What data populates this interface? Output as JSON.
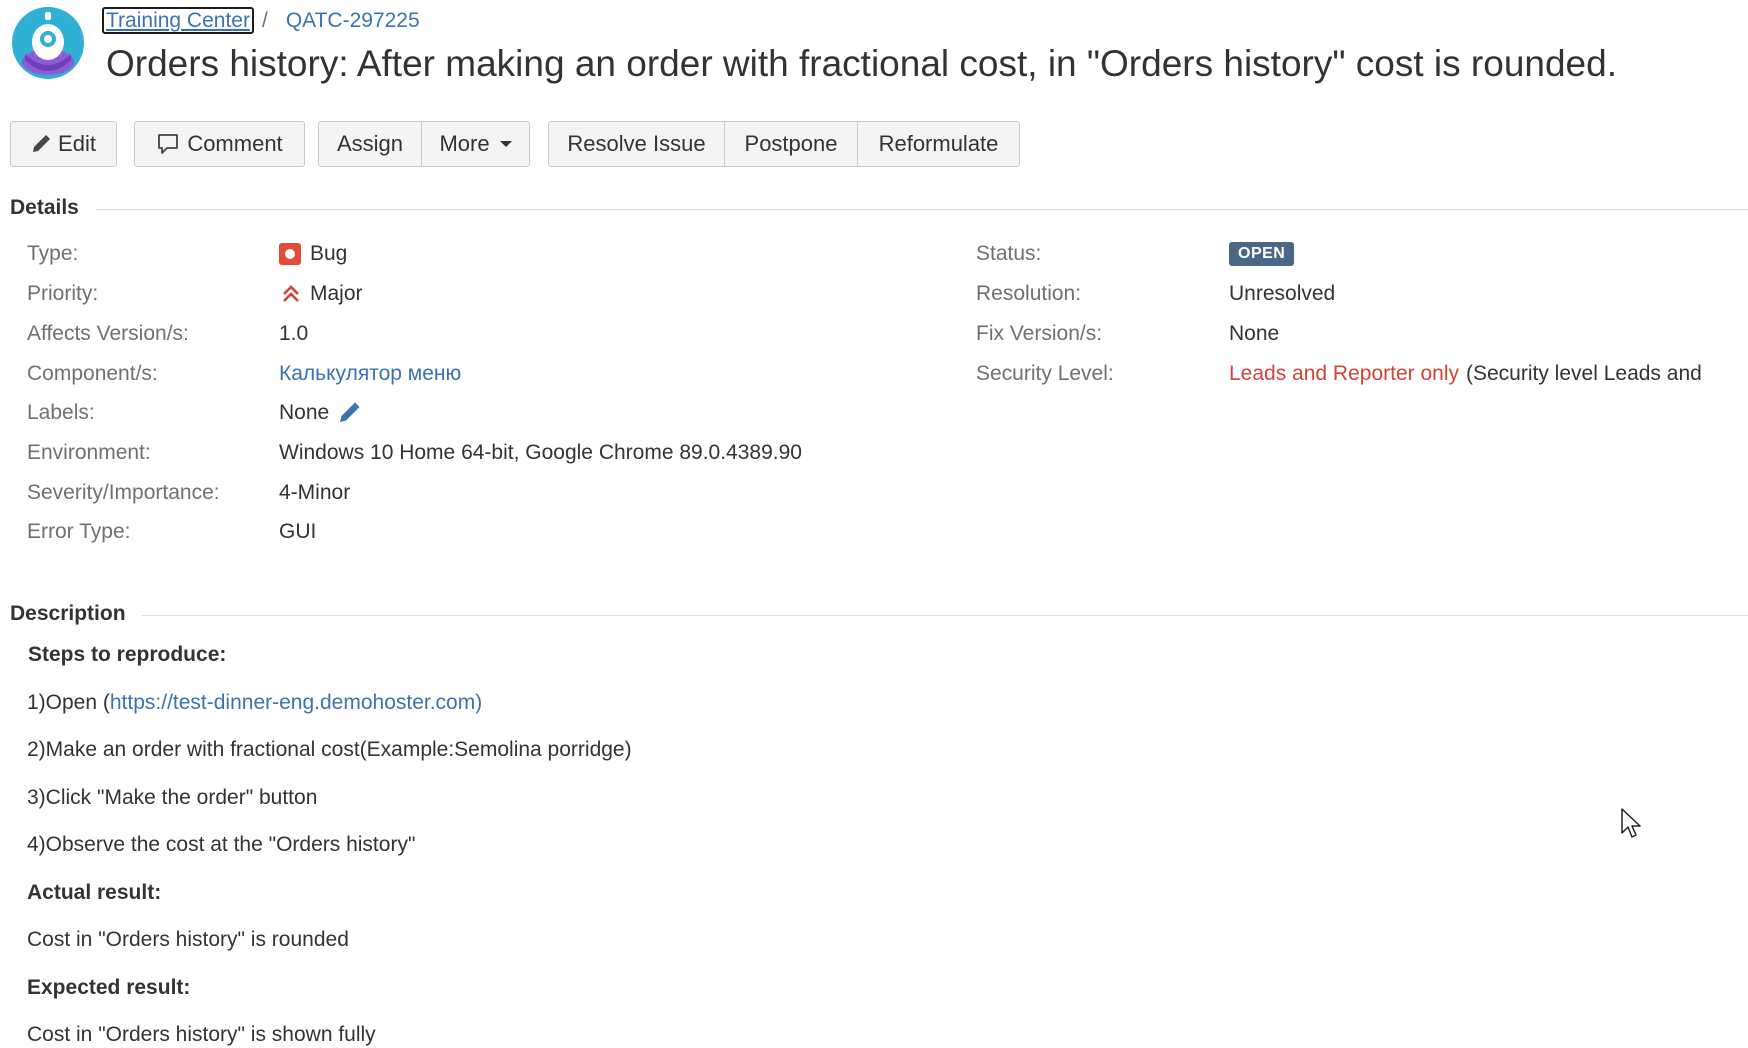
{
  "breadcrumb": {
    "project": "Training Center",
    "separator": "/",
    "issue_key": "QATC-297225"
  },
  "issue": {
    "title": "Orders history: After making an order with fractional cost, in \"Orders history\" cost is rounded."
  },
  "toolbar": {
    "edit": "Edit",
    "comment": "Comment",
    "assign": "Assign",
    "more": "More",
    "resolve": "Resolve Issue",
    "postpone": "Postpone",
    "reformulate": "Reformulate"
  },
  "details": {
    "heading": "Details",
    "left": {
      "type_label": "Type:",
      "type_value": "Bug",
      "priority_label": "Priority:",
      "priority_value": "Major",
      "affects_label": "Affects Version/s:",
      "affects_value": "1.0",
      "component_label": "Component/s:",
      "component_value": "Калькулятор меню",
      "labels_label": "Labels:",
      "labels_value": "None",
      "environment_label": "Environment:",
      "environment_value": "Windows 10 Home 64-bit, Google Chrome 89.0.4389.90",
      "severity_label": "Severity/Importance:",
      "severity_value": "4-Minor",
      "error_type_label": "Error Type:",
      "error_type_value": "GUI"
    },
    "right": {
      "status_label": "Status:",
      "status_value": "OPEN",
      "resolution_label": "Resolution:",
      "resolution_value": "Unresolved",
      "fix_label": "Fix Version/s:",
      "fix_value": "None",
      "security_label": "Security Level:",
      "security_value": "Leads and Reporter only",
      "security_note": "(Security level Leads and"
    }
  },
  "description": {
    "heading": "Description",
    "steps_heading": "Steps to reproduce:",
    "step1_prefix": "1)Open (",
    "step1_link": "https://test-dinner-eng.demohoster.com",
    "step1_suffix": ")",
    "step2": "2)Make an order with fractional cost(Example:Semolina porridge)",
    "step3": "3)Click \"Make the order\" button",
    "step4": "4)Observe the cost at the \"Orders history\"",
    "actual_heading": "Actual result:",
    "actual_text": "Cost in \"Orders history\" is rounded",
    "expected_heading": "Expected result:",
    "expected_text": "Cost in \"Orders history\" is shown fully"
  },
  "colors": {
    "link": "#3b73af",
    "status_lozenge": "#4a6785",
    "security_red": "#d04437",
    "bug_red": "#e5493a"
  },
  "icons": {
    "avatar": "project-avatar",
    "edit": "pencil-icon",
    "comment": "comment-icon",
    "bug": "bug-icon",
    "priority": "priority-major-icon",
    "labels_edit": "pencil-icon",
    "cursor": "mouse-cursor"
  }
}
